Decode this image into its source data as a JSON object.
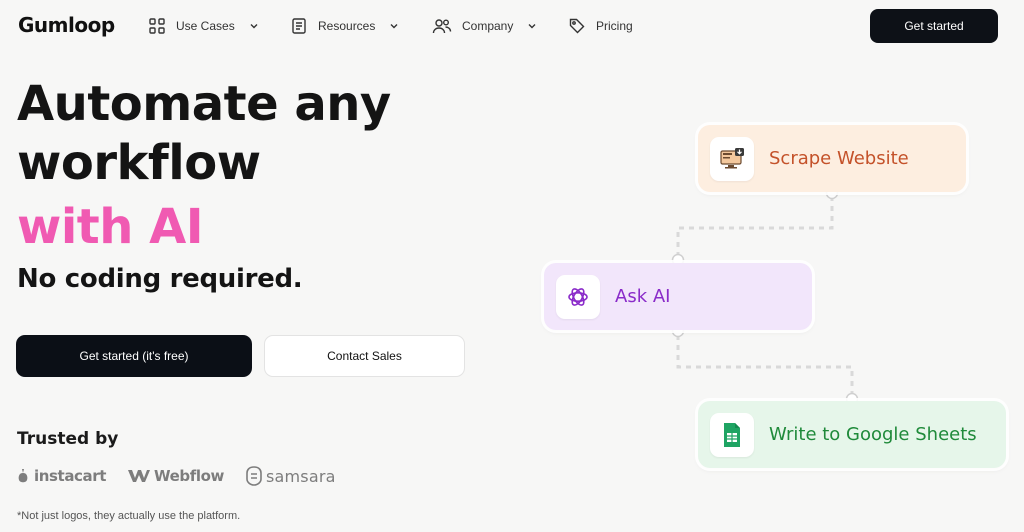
{
  "brand": {
    "logo_text": "Gumloop"
  },
  "nav": {
    "items": [
      {
        "label": "Use Cases",
        "icon": "grid-icon",
        "has_dropdown": true
      },
      {
        "label": "Resources",
        "icon": "notebook-icon",
        "has_dropdown": true
      },
      {
        "label": "Company",
        "icon": "people-icon",
        "has_dropdown": true
      },
      {
        "label": "Pricing",
        "icon": "tag-icon",
        "has_dropdown": false
      }
    ],
    "cta_label": "Get started"
  },
  "hero": {
    "line1": "Automate any",
    "line2": "workflow",
    "line3": "with AI",
    "subhead": "No coding required.",
    "primary_button": "Get started (it's free)",
    "secondary_button": "Contact Sales",
    "accent_color": "#f05ab2"
  },
  "trusted": {
    "heading": "Trusted by",
    "logos": [
      "instacart",
      "Webflow",
      "samsara"
    ],
    "footnote": "*Not just logos, they actually use the platform."
  },
  "workflow": {
    "nodes": [
      {
        "label": "Scrape Website",
        "icon": "monitor-download-icon",
        "color": "#c4522a"
      },
      {
        "label": "Ask AI",
        "icon": "openai-icon",
        "color": "#8a2bc9"
      },
      {
        "label": "Write to Google Sheets",
        "icon": "google-sheets-icon",
        "color": "#1f8a3a"
      }
    ]
  }
}
